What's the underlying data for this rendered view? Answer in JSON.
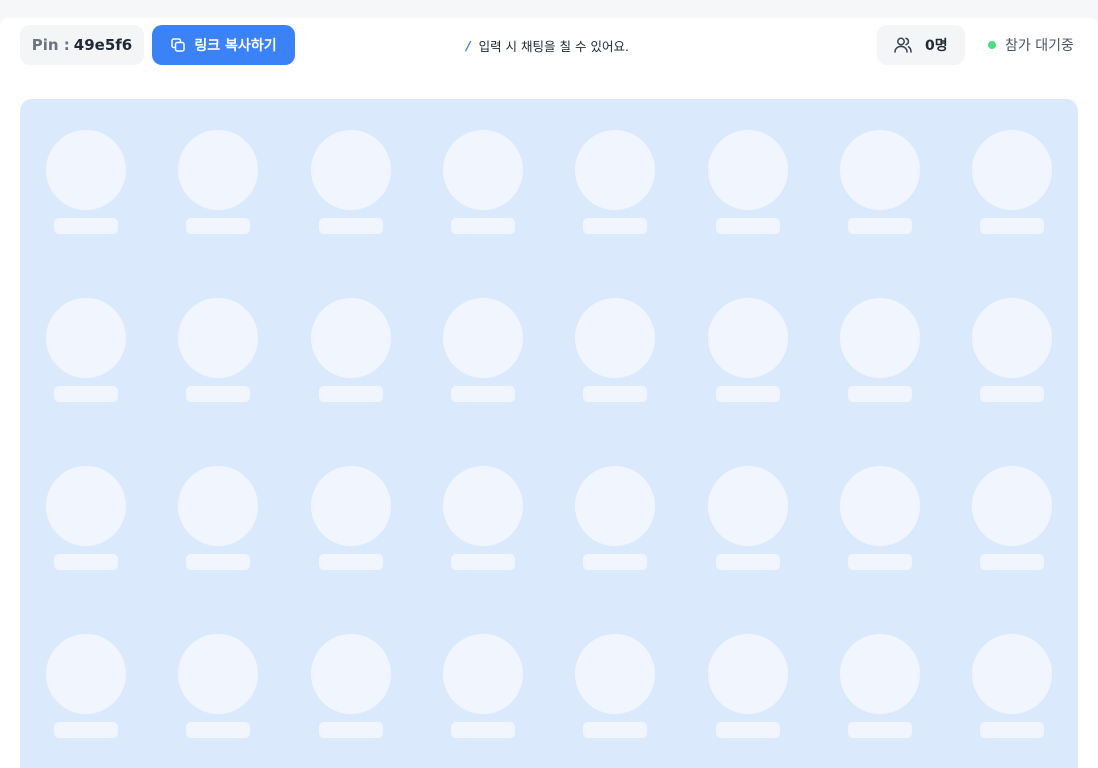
{
  "header": {
    "pin_label": "Pin :",
    "pin_code": "49e5f6",
    "copy_link_label": "링크 복사하기",
    "copy_icon": "copy-icon",
    "chat_hint_key": "/",
    "chat_hint_text": "입력 시 채팅을 칠 수 있어요.",
    "participant_icon": "users-icon",
    "participant_count": "0명",
    "status_text": "참가 대기중",
    "status_color": "#4ade80",
    "accent_color": "#3b82f6"
  },
  "grid": {
    "rows": 4,
    "columns": 8,
    "slot_state": "empty-placeholder"
  }
}
